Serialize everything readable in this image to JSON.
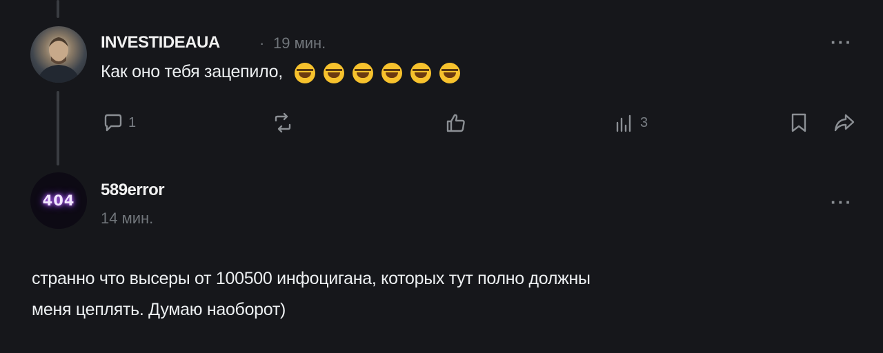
{
  "post": {
    "author": "INVESTIDEAUA",
    "separator": "·",
    "time": "19 мин.",
    "text": "Как оно тебя зацепило,",
    "emoji_count": 6,
    "emoji_name": "face-with-tears-of-joy",
    "actions": {
      "reply_count": "1",
      "repost_count": "",
      "like_count": "",
      "views_count": "3"
    },
    "more_label": "···"
  },
  "reply": {
    "author": "589error",
    "avatar_text": "404",
    "time": "14 мин.",
    "more_label": "···",
    "text_line1": "странно что высеры от 100500 инфоцигана, которых тут полно должны",
    "text_line2": "меня цеплять. Думаю наоборот)"
  },
  "colors": {
    "background": "#16171b",
    "muted": "#71767b",
    "thread_line": "#3a3d42"
  }
}
